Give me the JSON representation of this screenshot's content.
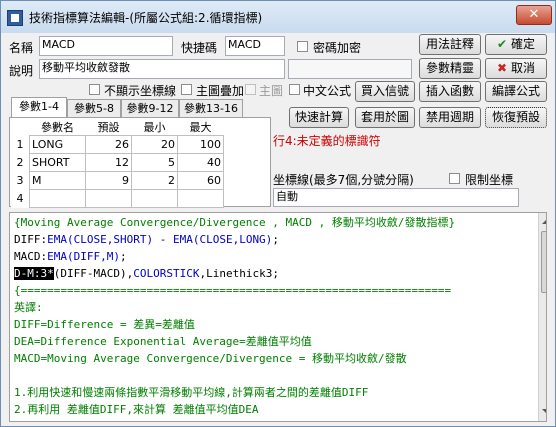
{
  "window": {
    "title": "技術指標算法編輯-(所屬公式組:2.循環指標)",
    "close_label": "✕"
  },
  "form": {
    "name_label": "名稱",
    "name_value": "MACD",
    "shortcut_label": "快捷碼",
    "shortcut_value": "MACD",
    "password_label": "密碼加密",
    "desc_label": "說明",
    "desc_value": "移動平均收斂發散",
    "no_axis_label": "不顯示坐標線",
    "main_overlay_label": "主圖疊加",
    "main_label": "主圖",
    "chinese_label": "中文公式"
  },
  "buttons": {
    "usage": "用法註釋",
    "ok": "確定",
    "ok_icon": "✔",
    "param_wizard": "參數精靈",
    "cancel": "取消",
    "cancel_icon": "✖",
    "buy_sell": "買入信號",
    "insert_func": "插入函數",
    "translate": "編譯公式",
    "quick_calc": "快速計算",
    "apply_chart": "套用於圖",
    "disable_period": "禁用週期",
    "restore_default": "恢復預設"
  },
  "tabs": [
    "參數1-4",
    "參數5-8",
    "參數9-12",
    "參數13-16"
  ],
  "params": {
    "headers": [
      "參數名",
      "預設",
      "最小",
      "最大"
    ],
    "rows": [
      {
        "n": "1",
        "name": "LONG",
        "def": "26",
        "min": "20",
        "max": "100"
      },
      {
        "n": "2",
        "name": "SHORT",
        "def": "12",
        "min": "5",
        "max": "40"
      },
      {
        "n": "3",
        "name": "M",
        "def": "9",
        "min": "2",
        "max": "60"
      },
      {
        "n": "4",
        "name": "",
        "def": "",
        "min": "",
        "max": ""
      }
    ]
  },
  "error_text": "行4:未定義的標識符",
  "axis": {
    "label": "坐標線(最多7個,分號分隔)",
    "limit_label": "限制坐標",
    "value": "自動"
  },
  "code": {
    "l1": "{Moving Average Convergence/Divergence , MACD , 移動平均收斂/發散指標}",
    "l2a": "DIFF:",
    "l2b": "EMA(CLOSE,SHORT)",
    "l2c": " - ",
    "l2d": "EMA(CLOSE,LONG)",
    "l2e": ";",
    "l3a": "MACD:",
    "l3b": "EMA(DIFF,M)",
    "l3c": ";",
    "l4sel": "D-M:3*",
    "l4a": "(DIFF-MACD),",
    "l4b": "COLORSTICK",
    "l4c": ",Linethick3;",
    "l5": "{=================================================================",
    "l6": "英譯:",
    "l7": "DIFF=Difference = 差異=差離值",
    "l8": "DEA=Difference Exponential Average=差離值平均值",
    "l9": "MACD=Moving Average Convergence/Divergence = 移動平均收斂/發散",
    "l10": "",
    "l11": "1.利用快速和慢速兩條指數平滑移動平均線,計算兩者之間的差離值DIFF",
    "l12": "2.再利用 差離值DIFF,來計算 差離值平均值DEA"
  }
}
